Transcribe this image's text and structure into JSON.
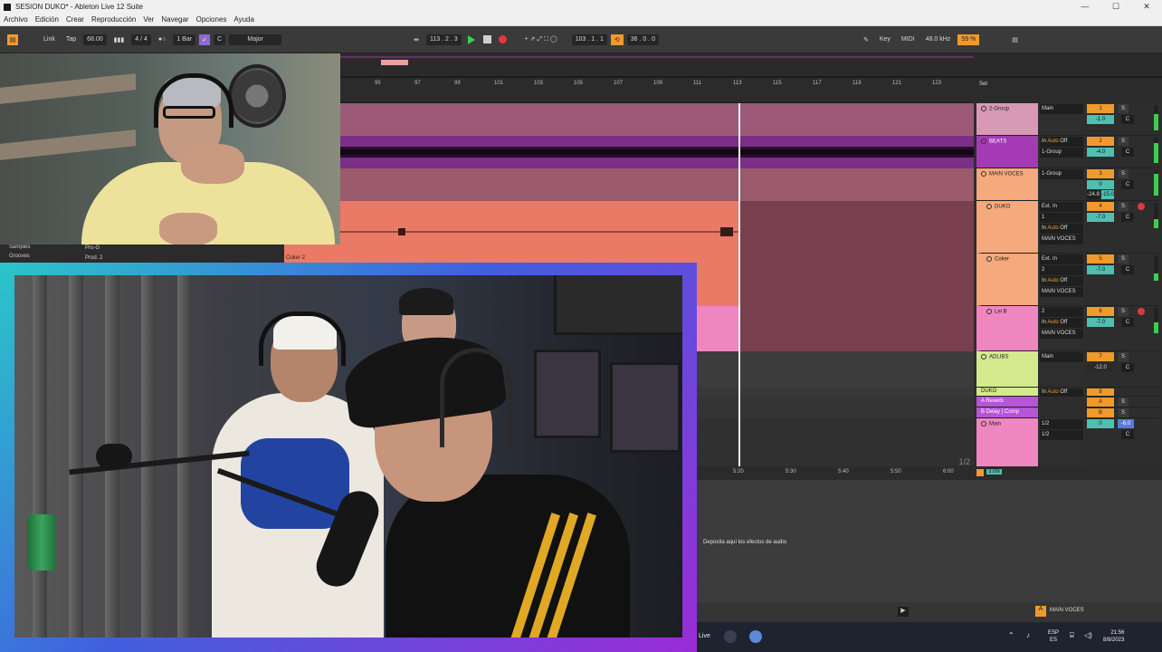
{
  "window": {
    "title": "SESION DUKO* - Ableton Live 12 Suite",
    "controls": [
      "—",
      "☐",
      "✕"
    ]
  },
  "menu": [
    "Archivo",
    "Edición",
    "Crear",
    "Reproducción",
    "Ver",
    "Navegar",
    "Opciones",
    "Ayuda"
  ],
  "transport": {
    "link": "Link",
    "tap": "Tap",
    "tempo": "68.00",
    "signature": "4 / 4",
    "quantize": "1 Bar",
    "key": "C",
    "scale": "Major",
    "position": "113 . 2 . 3",
    "loop_start": "103 . 1 . 1",
    "loop_length": "36 . 0 . 0",
    "key_label": "Key",
    "midi_label": "MIDI",
    "sample_rate": "48.0 kHz",
    "cpu": "59 %"
  },
  "ruler": {
    "bars": [
      "95",
      "97",
      "99",
      "101",
      "103",
      "105",
      "107",
      "109",
      "111",
      "113",
      "115",
      "117",
      "119",
      "121",
      "123"
    ],
    "set_label": "Set"
  },
  "tracks": [
    {
      "name": "2-Group",
      "color": "#d69ab4",
      "io_top": "Main",
      "num": "1",
      "volume": "-1.0",
      "pan": "C"
    },
    {
      "name": "BEATS",
      "color": "#a53ab5",
      "io_top": "1-Group",
      "num": "2",
      "volume": "-4.0",
      "pan": "C"
    },
    {
      "name": "MAIN VOCES",
      "color": "#f5a97c",
      "io_top": "1-Group",
      "num": "3",
      "volume": "0",
      "pan": "C",
      "extra": [
        "-24.8",
        "-15.0"
      ]
    },
    {
      "name": "DUKO",
      "color": "#f5a97c",
      "io_top": "Ext. In",
      "io_mid": "1",
      "io_bot": "MAIN VOCES",
      "num": "4",
      "volume": "-7.0",
      "pan": "C"
    },
    {
      "name": "Coker",
      "color": "#f5a97c",
      "io_top": "Ext. In",
      "io_mid": "2",
      "io_bot": "MAIN VOCES",
      "num": "5",
      "volume": "-7.0",
      "pan": "C"
    },
    {
      "name": "Lei B",
      "color": "#ef86c0",
      "io_top": "2",
      "io_bot": "MAIN VOCES",
      "num": "6",
      "volume": "-7.0",
      "pan": "C"
    },
    {
      "name": "ADLIBS",
      "color": "#d4ea8e",
      "io_top": "Main",
      "num": "7",
      "volume": "-12.0",
      "pan": "C"
    },
    {
      "name": "DUKO",
      "color": "#d4ea8e",
      "io_top": "Auto",
      "num": "8",
      "volume": "",
      "pan": ""
    },
    {
      "name": "A Reverb",
      "color": "#b655d6",
      "num": "A",
      "volume": "",
      "pan": ""
    },
    {
      "name": "B Delay | Comp",
      "color": "#b655d6",
      "num": "B",
      "volume": "",
      "pan": ""
    },
    {
      "name": "Main",
      "color": "#ef86c0",
      "io_top": "1/2",
      "io_mid": "1/2",
      "num": "0",
      "volume": "-6.0",
      "pan": "C"
    }
  ],
  "io_labels": {
    "in": "In",
    "auto": "Auto",
    "off": "Off",
    "solo": "S",
    "minus_inf": "-inf"
  },
  "arrangement": {
    "page": "1/2",
    "zoom": "3.0fx"
  },
  "time_ruler": [
    "5:20",
    "5:30",
    "5:40",
    "5:50",
    "6:00"
  ],
  "detail": {
    "drop_hint": "Deposita aquí los efectos de audio"
  },
  "status": {
    "selected_track": "MAIN VOCES"
  },
  "browser": {
    "items": [
      "Samples",
      "Grooves"
    ],
    "files": [
      "Pro-G",
      "Prod. 2"
    ],
    "clip": "Coker 2"
  },
  "taskbar": {
    "app": "Live",
    "lang_top": "ESP",
    "lang_bot": "ES",
    "time": "21:56",
    "date": "8/8/2023"
  },
  "colors": {
    "accent": "#f09a2c",
    "play": "#3ad04a",
    "record": "#e0383e",
    "teal": "#4fbfb0"
  }
}
